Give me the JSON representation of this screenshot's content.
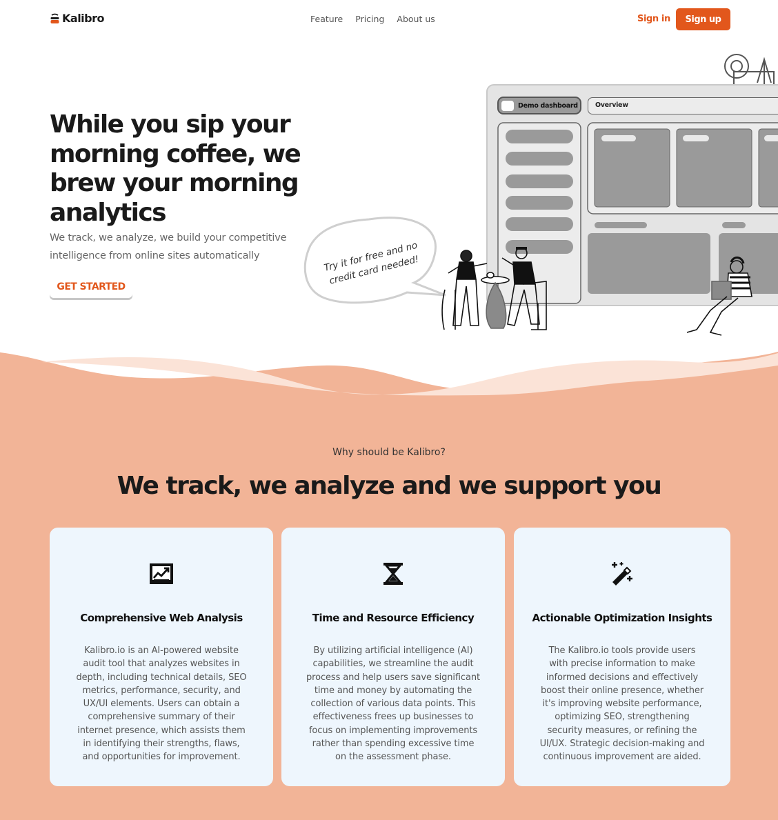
{
  "nav": {
    "brand": "Kalibro",
    "links": [
      "Feature",
      "Pricing",
      "About us"
    ],
    "sign_in": "Sign in",
    "sign_up": "Sign up"
  },
  "hero": {
    "title": "While you sip your morning coffee, we brew your morning analytics",
    "subtitle": "We track, we analyze, we build your competitive intelligence from online sites automatically",
    "cta": "GET STARTED",
    "speech": "Try it for free and no credit card needed!",
    "demo_tab": "Demo dashboard",
    "overview_tab": "Overview"
  },
  "why": {
    "eyebrow": "Why should be Kalibro?",
    "heading": "We track, we analyze and we support you"
  },
  "features": [
    {
      "icon": "chart-growth-icon",
      "title": "Comprehensive Web Analysis",
      "body": "Kalibro.io is an AI-powered website audit tool that analyzes websites in depth, including technical details, SEO metrics, performance, security, and UX/UI elements. Users can obtain a comprehensive summary of their internet presence, which assists them in identifying their strengths, flaws, and opportunities for improvement."
    },
    {
      "icon": "hourglass-icon",
      "title": "Time and Resource Efficiency",
      "body": "By utilizing artificial intelligence (AI) capabilities, we streamline the audit process and help users save significant time and money by automating the collection of various data points. This effectiveness frees up businesses to focus on implementing improvements rather than spending excessive time on the assessment phase."
    },
    {
      "icon": "magic-wand-icon",
      "title": "Actionable Optimization Insights",
      "body": "The Kalibro.io tools provide users with precise information to make informed decisions and effectively boost their online presence, whether it's improving website performance, optimizing SEO, strengthening security measures, or refining the UI/UX. Strategic decision-making and continuous improvement are aided."
    }
  ],
  "colors": {
    "accent": "#e2571c",
    "section_bg": "#f2b497",
    "card_bg": "#eef6fd"
  }
}
